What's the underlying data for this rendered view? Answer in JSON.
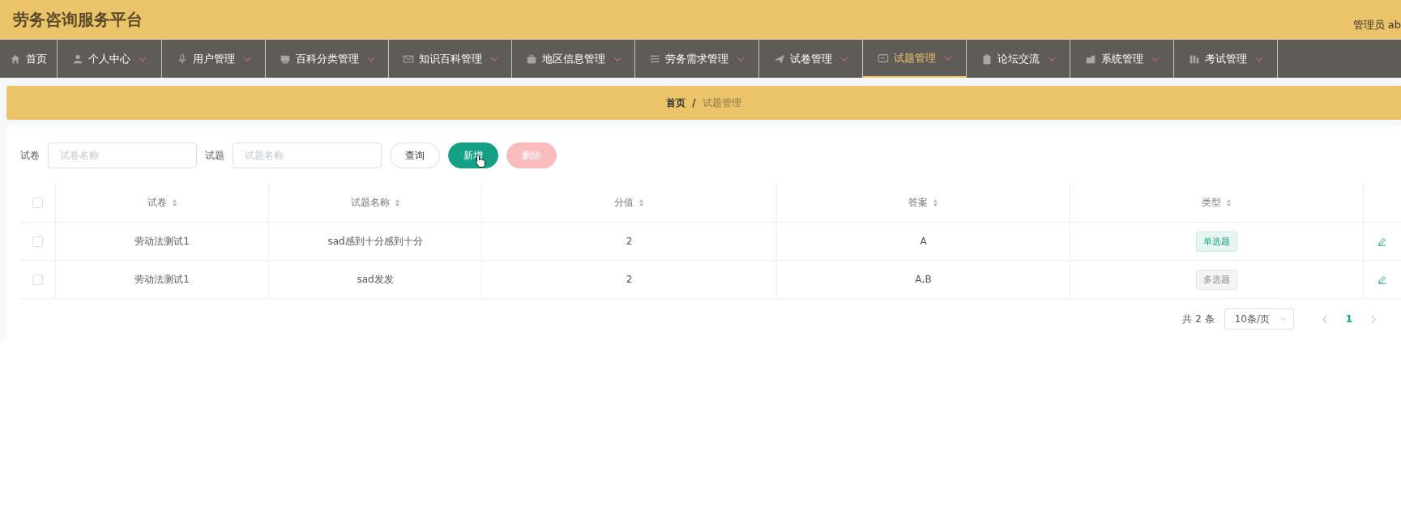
{
  "header": {
    "title": "劳务咨询服务平台",
    "user": "管理员 ab"
  },
  "nav": [
    {
      "label": "首页",
      "caret": false,
      "selected": false
    },
    {
      "label": "个人中心",
      "caret": true,
      "selected": false
    },
    {
      "label": "用户管理",
      "caret": true,
      "selected": false
    },
    {
      "label": "百科分类管理",
      "caret": true,
      "selected": false
    },
    {
      "label": "知识百科管理",
      "caret": true,
      "selected": false
    },
    {
      "label": "地区信息管理",
      "caret": true,
      "selected": false
    },
    {
      "label": "劳务需求管理",
      "caret": true,
      "selected": false
    },
    {
      "label": "试卷管理",
      "caret": true,
      "selected": false
    },
    {
      "label": "试题管理",
      "caret": true,
      "selected": true
    },
    {
      "label": "论坛交流",
      "caret": true,
      "selected": false
    },
    {
      "label": "系统管理",
      "caret": true,
      "selected": false
    },
    {
      "label": "考试管理",
      "caret": true,
      "selected": false
    }
  ],
  "breadcrumb": {
    "separator": "/",
    "items": [
      "首页",
      "试题管理"
    ]
  },
  "search": {
    "fields": [
      {
        "label": "试卷",
        "placeholder": "试卷名称"
      },
      {
        "label": "试题",
        "placeholder": "试题名称"
      }
    ],
    "buttons": [
      {
        "label": "查询",
        "kind": "plain",
        "disabled": false
      },
      {
        "label": "新增",
        "kind": "success",
        "disabled": false
      },
      {
        "label": "删除",
        "kind": "danger",
        "disabled": true
      }
    ]
  },
  "table": {
    "all_checked": false,
    "columns": [
      "试卷",
      "试题名称",
      "分值",
      "答案",
      "类型"
    ],
    "rows": [
      {
        "checked": false,
        "cells": [
          "劳动法测试1",
          "sad感到十分感到十分",
          "2",
          "A"
        ],
        "type": {
          "text": "单选题",
          "kind": "success"
        }
      },
      {
        "checked": false,
        "cells": [
          "劳动法测试1",
          "sad发发",
          "2",
          "A,B"
        ],
        "type": {
          "text": "多选题",
          "kind": "info"
        }
      }
    ]
  },
  "pagination": {
    "total": "共 2 条",
    "page_size": "10条/页",
    "pages": [
      {
        "label": "1",
        "selected": true
      }
    ]
  }
}
